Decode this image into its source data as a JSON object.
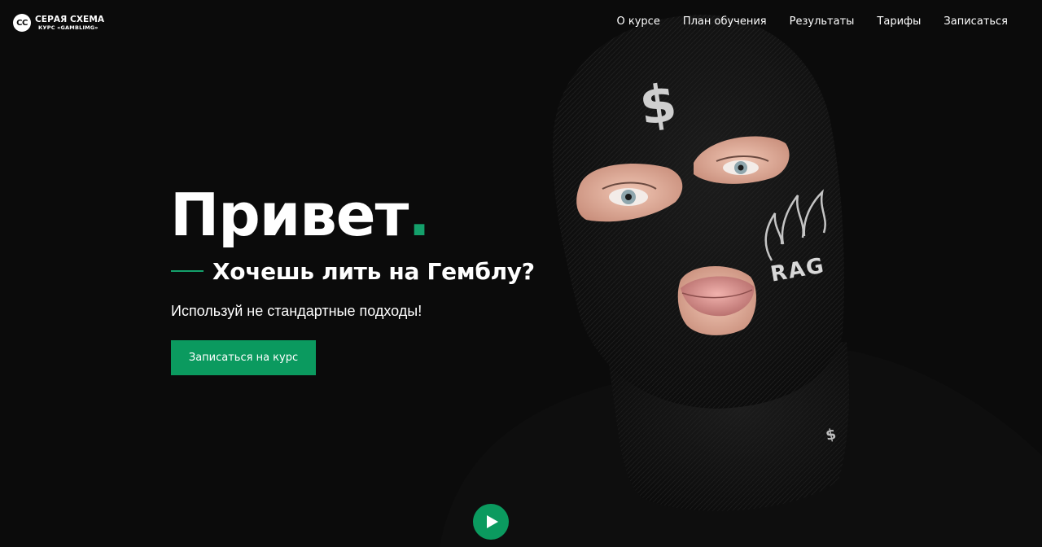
{
  "brand": {
    "badge": "СС",
    "title": "СЕРАЯ СХЕМА",
    "subtitle": "КУРС «GAMBLIMG»"
  },
  "nav": {
    "items": [
      {
        "label": "О курсе"
      },
      {
        "label": "План обучения"
      },
      {
        "label": "Результаты"
      },
      {
        "label": "Тарифы"
      },
      {
        "label": "Записаться"
      }
    ]
  },
  "hero": {
    "title": "Привет",
    "title_dot": ".",
    "subtitle": "Хочешь лить на Гемблу?",
    "tagline": "Используй не стандартные подходы!",
    "cta_label": "Записаться на курс",
    "play_icon": "play-icon"
  },
  "photo": {
    "forehead_symbol": "$",
    "cheek_text": "RAG",
    "neck_symbol": "$"
  },
  "colors": {
    "background": "#0b0b0b",
    "accent": "#14a06b",
    "button": "#0b9a5f",
    "text": "#ffffff"
  }
}
